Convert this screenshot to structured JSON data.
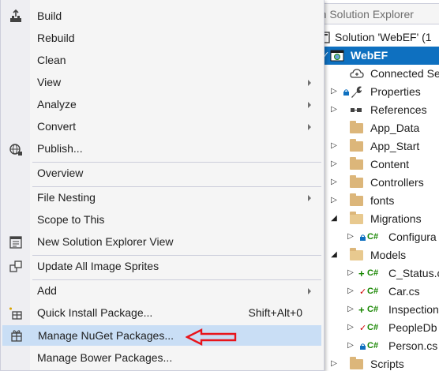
{
  "solution_explorer": {
    "search_placeholder": "rch Solution Explorer",
    "solution_label": "Solution 'WebEF' (1",
    "project_label": "WebEF",
    "items": [
      {
        "label": "Connected Se"
      },
      {
        "label": "Properties"
      },
      {
        "label": "References"
      },
      {
        "label": "App_Data"
      },
      {
        "label": "App_Start"
      },
      {
        "label": "Content"
      },
      {
        "label": "Controllers"
      },
      {
        "label": "fonts"
      },
      {
        "label": "Migrations"
      },
      {
        "label": "Configura"
      },
      {
        "label": "Models"
      },
      {
        "label": "C_Status.c"
      },
      {
        "label": "Car.cs"
      },
      {
        "label": "Inspection"
      },
      {
        "label": "PeopleDb"
      },
      {
        "label": "Person.cs"
      },
      {
        "label": "Scripts"
      }
    ]
  },
  "context_menu": {
    "build": "Build",
    "rebuild": "Rebuild",
    "clean": "Clean",
    "view": "View",
    "analyze": "Analyze",
    "convert": "Convert",
    "publish": "Publish...",
    "overview": "Overview",
    "file_nesting": "File Nesting",
    "scope_to_this": "Scope to This",
    "new_se_view": "New Solution Explorer View",
    "update_sprites": "Update All Image Sprites",
    "add": "Add",
    "quick_install": "Quick Install Package...",
    "quick_install_shortcut": "Shift+Alt+0",
    "manage_nuget": "Manage NuGet Packages...",
    "manage_bower": "Manage Bower Packages..."
  },
  "colors": {
    "selection_blue": "#0e70c0",
    "menu_highlight": "#c9def5",
    "annotation_red": "#e8141b",
    "csharp_green": "#178600",
    "folder_tan": "#dcb67a"
  }
}
